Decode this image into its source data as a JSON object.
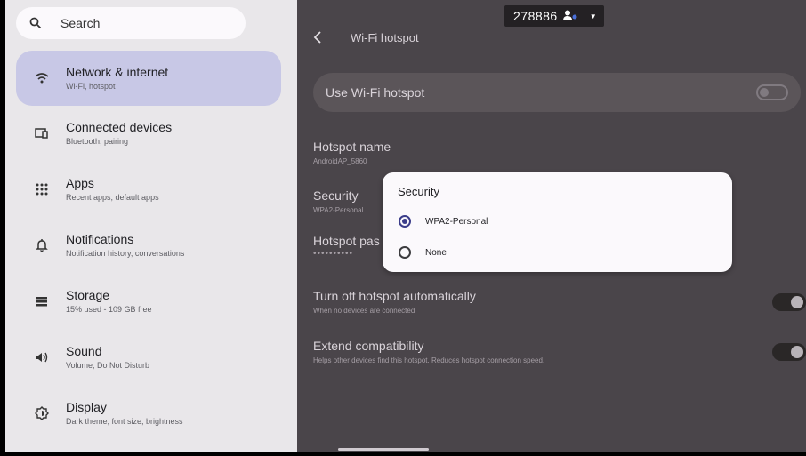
{
  "search": {
    "label": "Search"
  },
  "sidebar": {
    "items": [
      {
        "title": "Network & internet",
        "subtitle": "Wi-Fi, hotspot",
        "icon": "wifi-icon",
        "active": true
      },
      {
        "title": "Connected devices",
        "subtitle": "Bluetooth, pairing",
        "icon": "devices-icon",
        "active": false
      },
      {
        "title": "Apps",
        "subtitle": "Recent apps, default apps",
        "icon": "apps-grid-icon",
        "active": false
      },
      {
        "title": "Notifications",
        "subtitle": "Notification history, conversations",
        "icon": "bell-icon",
        "active": false
      },
      {
        "title": "Storage",
        "subtitle": "15% used - 109 GB free",
        "icon": "storage-icon",
        "active": false
      },
      {
        "title": "Sound",
        "subtitle": "Volume, Do Not Disturb",
        "icon": "speaker-icon",
        "active": false
      },
      {
        "title": "Display",
        "subtitle": "Dark theme, font size, brightness",
        "icon": "display-icon",
        "active": false
      }
    ]
  },
  "status": {
    "number": "278886"
  },
  "page": {
    "title": "Wi-Fi hotspot",
    "use_hotspot": "Use Wi-Fi hotspot",
    "hotspot_name": {
      "title": "Hotspot name",
      "value": "AndroidAP_5860"
    },
    "security": {
      "title": "Security",
      "value": "WPA2-Personal"
    },
    "hotspot_password": {
      "title": "Hotspot pas",
      "value": "••••••••••"
    },
    "turn_off": {
      "title": "Turn off hotspot automatically",
      "subtitle": "When no devices are connected"
    },
    "extend": {
      "title": "Extend compatibility",
      "subtitle": "Helps other devices find this hotspot. Reduces hotspot connection speed."
    }
  },
  "dialog": {
    "title": "Security",
    "options": [
      {
        "label": "WPA2-Personal",
        "selected": true
      },
      {
        "label": "None",
        "selected": false
      }
    ]
  },
  "colors": {
    "accent": "#3b3d8a",
    "active_item": "#c8c8e6",
    "right_bg": "#4a454a"
  }
}
